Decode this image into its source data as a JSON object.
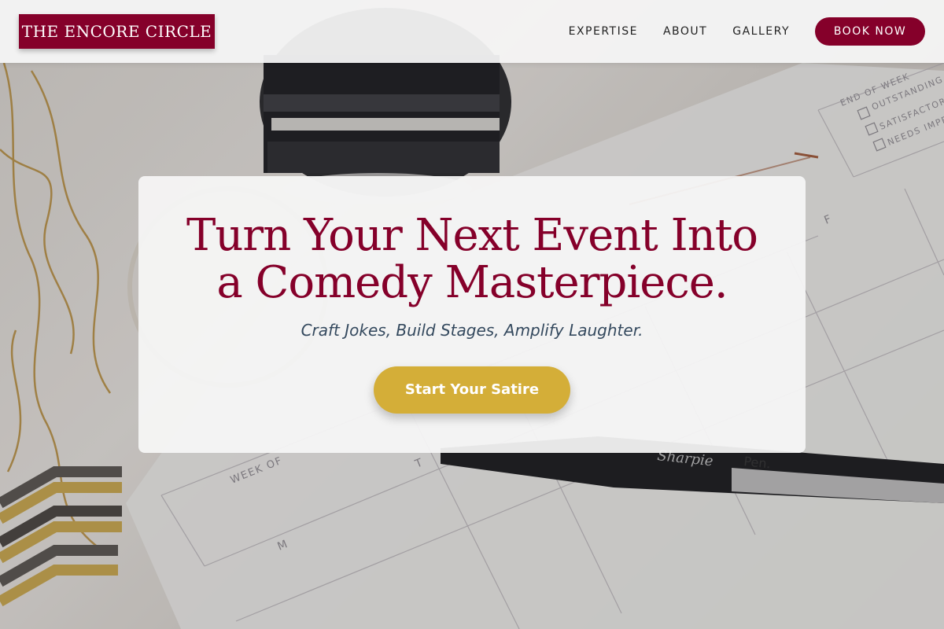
{
  "brand": {
    "logo_text": "THE ENCORE CIRCLE",
    "primary_color": "#85002a",
    "accent_color": "#d4ae38"
  },
  "nav": {
    "links": [
      "EXPERTISE",
      "ABOUT",
      "GALLERY"
    ],
    "cta_label": "BOOK NOW"
  },
  "hero": {
    "title": "Turn Your Next Event Into a Comedy Masterpiece.",
    "subtitle": "Craft Jokes, Build Stages, Amplify Laughter.",
    "cta_label": "Start Your Satire"
  },
  "background": {
    "planner_texts": [
      "END OF WEEK",
      "OUTSTANDING",
      "SATISFACTORY",
      "NEEDS IMPR",
      "WEEK OF",
      "M",
      "T",
      "F",
      "Sharpie",
      "Pen."
    ]
  }
}
